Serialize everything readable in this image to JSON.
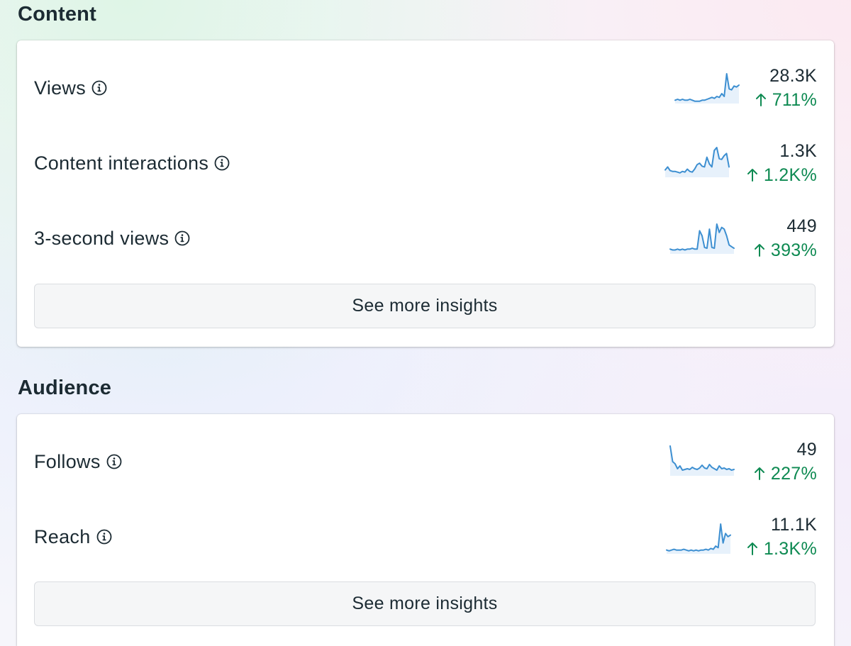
{
  "content": {
    "title": "Content",
    "metrics": [
      {
        "label": "Views",
        "value": "28.3K",
        "change": "711%",
        "trend": [
          2,
          3,
          2,
          3,
          2,
          2,
          3,
          2,
          1,
          1,
          1,
          2,
          2,
          3,
          4,
          5,
          4,
          6,
          5,
          9,
          6,
          30,
          14,
          13,
          17,
          16,
          18
        ]
      },
      {
        "label": "Content interactions",
        "value": "1.3K",
        "change": "1.2K%",
        "trend": [
          8,
          12,
          7,
          6,
          6,
          5,
          4,
          6,
          5,
          9,
          6,
          5,
          9,
          15,
          17,
          13,
          12,
          25,
          16,
          12,
          34,
          38,
          23,
          22,
          27,
          30,
          12
        ]
      },
      {
        "label": "3-second views",
        "value": "449",
        "change": "393%",
        "trend": [
          4,
          3,
          3,
          4,
          3,
          4,
          3,
          4,
          4,
          5,
          4,
          4,
          26,
          20,
          6,
          5,
          28,
          6,
          5,
          34,
          24,
          30,
          28,
          20,
          9,
          7,
          5
        ]
      }
    ],
    "button_label": "See more insights"
  },
  "audience": {
    "title": "Audience",
    "metrics": [
      {
        "label": "Follows",
        "value": "49",
        "change": "227%",
        "trend": [
          40,
          18,
          15,
          8,
          12,
          6,
          7,
          8,
          7,
          10,
          8,
          7,
          9,
          13,
          9,
          8,
          14,
          10,
          8,
          6,
          12,
          8,
          9,
          7,
          8,
          6,
          7
        ]
      },
      {
        "label": "Reach",
        "value": "11.1K",
        "change": "1.3K%",
        "trend": [
          3,
          2,
          3,
          4,
          3,
          3,
          3,
          4,
          3,
          2,
          3,
          2,
          3,
          2,
          3,
          3,
          4,
          3,
          5,
          4,
          8,
          6,
          36,
          12,
          24,
          20,
          22
        ]
      }
    ],
    "button_label": "See more insights"
  },
  "colors": {
    "sparkline_stroke": "#3d8fd1",
    "sparkline_fill": "#e7f1fb",
    "positive_change": "#0e8a52"
  },
  "icons": {
    "info": "info-circle-icon",
    "up_arrow": "arrow-up-icon"
  }
}
